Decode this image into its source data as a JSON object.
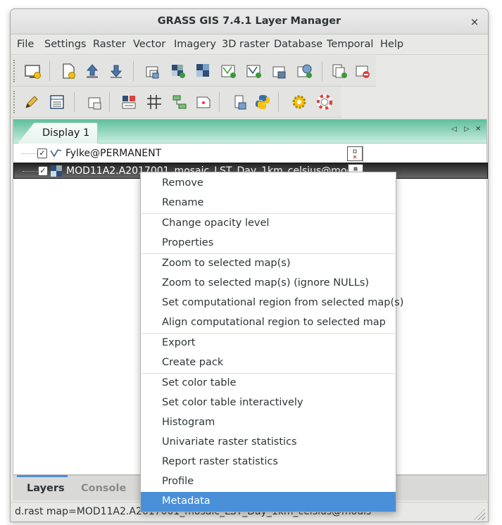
{
  "window": {
    "title": "GRASS GIS 7.4.1 Layer Manager",
    "close_glyph": "×"
  },
  "menubar": {
    "items": [
      "File",
      "Settings",
      "Raster",
      "Vector",
      "Imagery",
      "3D raster",
      "Database",
      "Temporal",
      "Help"
    ]
  },
  "toolbar1": {
    "buttons": [
      "new-display-icon",
      "new-workspace-icon",
      "open-workspace-icon",
      "save-workspace-icon",
      "add-raster-icon",
      "add-multiple-raster-icon",
      "add-raster-overlay-icon",
      "add-vector-icon",
      "add-multiple-vector-icon",
      "add-vector-overlay-icon",
      "add-web-service-icon",
      "add-group-icon",
      "remove-layer-icon"
    ]
  },
  "toolbar2": {
    "buttons": [
      "edit-vector-icon",
      "attribute-table-icon",
      "add-command-layer-icon",
      "georectifier-icon",
      "graphical-modeler-icon",
      "cartographic-composer-icon",
      "map-swipe-icon",
      "script-icon",
      "python-shell-icon",
      "settings-icon",
      "help-icon"
    ]
  },
  "notebook": {
    "tab_label": "Display 1",
    "controls": [
      "◁",
      "▷",
      "✕"
    ],
    "layers": [
      {
        "name": "Fylke@PERMANENT",
        "checked": "✓",
        "type_icon": "vector-layer-icon"
      },
      {
        "name": "MOD11A2.A2017001_mosaic_LST_Day_1km_celsius@modis",
        "checked": "✓",
        "type_icon": "raster-layer-icon"
      }
    ]
  },
  "context_menu": {
    "items": [
      "Remove",
      "Rename",
      "Change opacity level",
      "Properties",
      "Zoom to selected map(s)",
      "Zoom to selected map(s) (ignore NULLs)",
      "Set computational region from selected map(s)",
      "Align computational region to selected map",
      "Export",
      "Create pack",
      "Set color table",
      "Set color table interactively",
      "Histogram",
      "Univariate raster statistics",
      "Report raster statistics",
      "Profile",
      "Metadata"
    ],
    "highlighted": "Metadata"
  },
  "bottom_tabs": {
    "layers": "Layers",
    "console": "Console"
  },
  "statusbar": {
    "text": "d.rast map=MOD11A2.A2017001_mosaic_LST_Day_1km_celsius@modis"
  },
  "colors": {
    "accent": "#4a90d9",
    "tab_gradient_top": "#5fbf9c",
    "tab_gradient_bottom": "#c9ece0"
  }
}
